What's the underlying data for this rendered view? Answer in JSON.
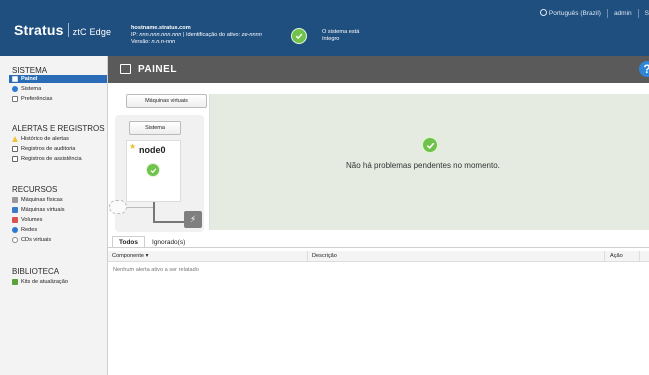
{
  "header": {
    "brand_name": "Stratus",
    "product": "ztC Edge",
    "hostname": "hostname.stratus.com",
    "ip_label": "IP: ",
    "ip_value": "nnn.nnn.nnn.nnn",
    "asset_label": " | Identificação do ativo: ",
    "asset_value": "ze-nnnn",
    "version_label": "Versão: ",
    "version_value": "n.n.n-nnn",
    "status_line1": "O sistema está",
    "status_line2": "íntegro",
    "language": "Português (Brazil)",
    "user": "admin",
    "extra": "S"
  },
  "sidebar": {
    "sistema": {
      "title": "SISTEMA",
      "items": [
        {
          "label": "Painel",
          "icon": "dashboard-icon",
          "active": true
        },
        {
          "label": "Sistema",
          "icon": "system-globe-icon"
        },
        {
          "label": "Preferências",
          "icon": "preferences-icon"
        }
      ]
    },
    "alertas": {
      "title": "ALERTAS E REGISTROS",
      "items": [
        {
          "label": "Histórico de alertas",
          "icon": "warning-icon"
        },
        {
          "label": "Registros de auditoria",
          "icon": "audit-log-icon"
        },
        {
          "label": "Registros de assistência",
          "icon": "support-log-icon"
        }
      ]
    },
    "recursos": {
      "title": "RECURSOS",
      "items": [
        {
          "label": "Máquinas físicas",
          "icon": "physical-machine-icon"
        },
        {
          "label": "Máquinas virtuais",
          "icon": "virtual-machine-icon"
        },
        {
          "label": "Volumes",
          "icon": "volume-icon"
        },
        {
          "label": "Redes",
          "icon": "network-icon"
        },
        {
          "label": "CDs virtuais",
          "icon": "virtual-cd-icon"
        }
      ]
    },
    "biblioteca": {
      "title": "BIBLIOTECA",
      "items": [
        {
          "label": "Kits de atualização",
          "icon": "upgrade-kit-icon"
        }
      ]
    }
  },
  "main": {
    "title": "PAINEL",
    "help": "?",
    "topology": {
      "vm_button": "Máquinas virtuais",
      "system_button": "Sistema",
      "node_name": "node0"
    },
    "status_message": "Não há problemas pendentes no momento.",
    "alerts": {
      "tabs": [
        "Todos",
        "Ignorado(s)"
      ],
      "columns": [
        "Componente",
        "Descrição",
        "Ação"
      ],
      "sort_indicator": "▾",
      "empty_text": "Nenhum alerta ativo a ser relatado"
    }
  },
  "colors": {
    "header_bg": "#1f4f7f",
    "active_nav": "#2b6cb6",
    "ok_green": "#6fc24b",
    "main_header_bg": "#5a5a5a",
    "status_panel_bg": "#e6ebe1"
  }
}
